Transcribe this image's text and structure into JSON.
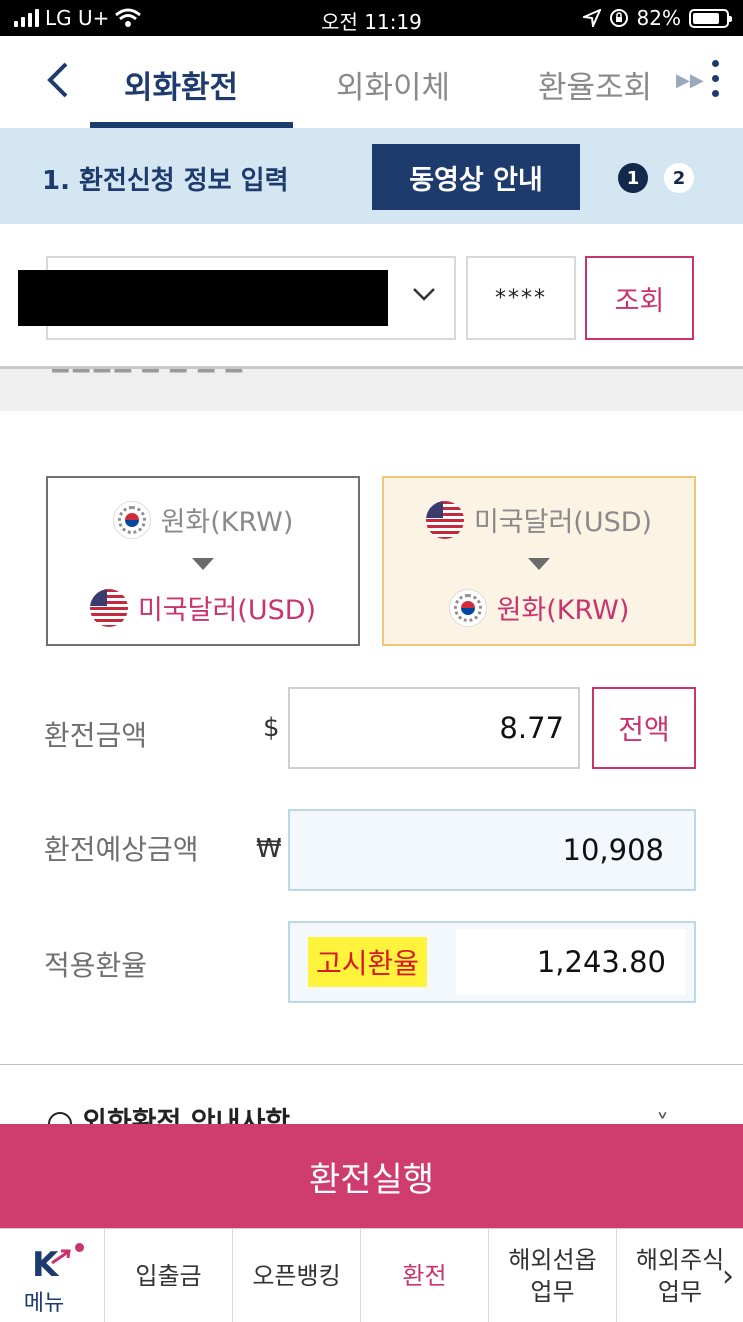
{
  "status_bar": {
    "carrier": "LG U+",
    "time": "오전 11:19",
    "battery": "82%",
    "battery_level": 0.82
  },
  "header": {
    "tabs": [
      {
        "label": "외화환전",
        "active": true
      },
      {
        "label": "외화이체",
        "active": false
      },
      {
        "label": "환율조회",
        "active": false
      }
    ]
  },
  "step": {
    "title": "1. 환전신청 정보 입력",
    "video_button": "동영상 안내",
    "steps": [
      "1",
      "2"
    ],
    "current": 1
  },
  "account": {
    "password_mask": "****",
    "query_button": "조회"
  },
  "direction": {
    "left": {
      "from": "원화(KRW)",
      "to": "미국달러(USD)",
      "from_flag": "kr-flag-icon",
      "to_flag": "us-flag-icon"
    },
    "right": {
      "from": "미국달러(USD)",
      "to": "원화(KRW)",
      "from_flag": "us-flag-icon",
      "to_flag": "kr-flag-icon",
      "selected": true
    }
  },
  "form": {
    "amount_label": "환전금액",
    "amount_symbol": "$",
    "amount_value": "8.77",
    "all_button": "전액",
    "estimate_label": "환전예상금액",
    "estimate_symbol": "₩",
    "estimate_value": "10,908",
    "rate_label": "적용환율",
    "rate_tag": "고시환율",
    "rate_value": "1,243.80"
  },
  "info": {
    "title": "외화환전 안내사항"
  },
  "execute_button": "환전실행",
  "bottom_nav": {
    "menu_label": "메뉴",
    "items": [
      {
        "label": "입출금",
        "active": false
      },
      {
        "label": "오픈뱅킹",
        "active": false
      },
      {
        "label": "환전",
        "active": true
      },
      {
        "label": "해외선옵\n업무",
        "active": false
      },
      {
        "label": "해외주식\n업무",
        "active": false
      }
    ]
  },
  "colors": {
    "brand_navy": "#1e3b6e",
    "accent_pink": "#c9336f",
    "execute_bg": "#cf3c6e",
    "step_bg": "#d4e6f2",
    "highlight_yellow": "#fff33b"
  }
}
